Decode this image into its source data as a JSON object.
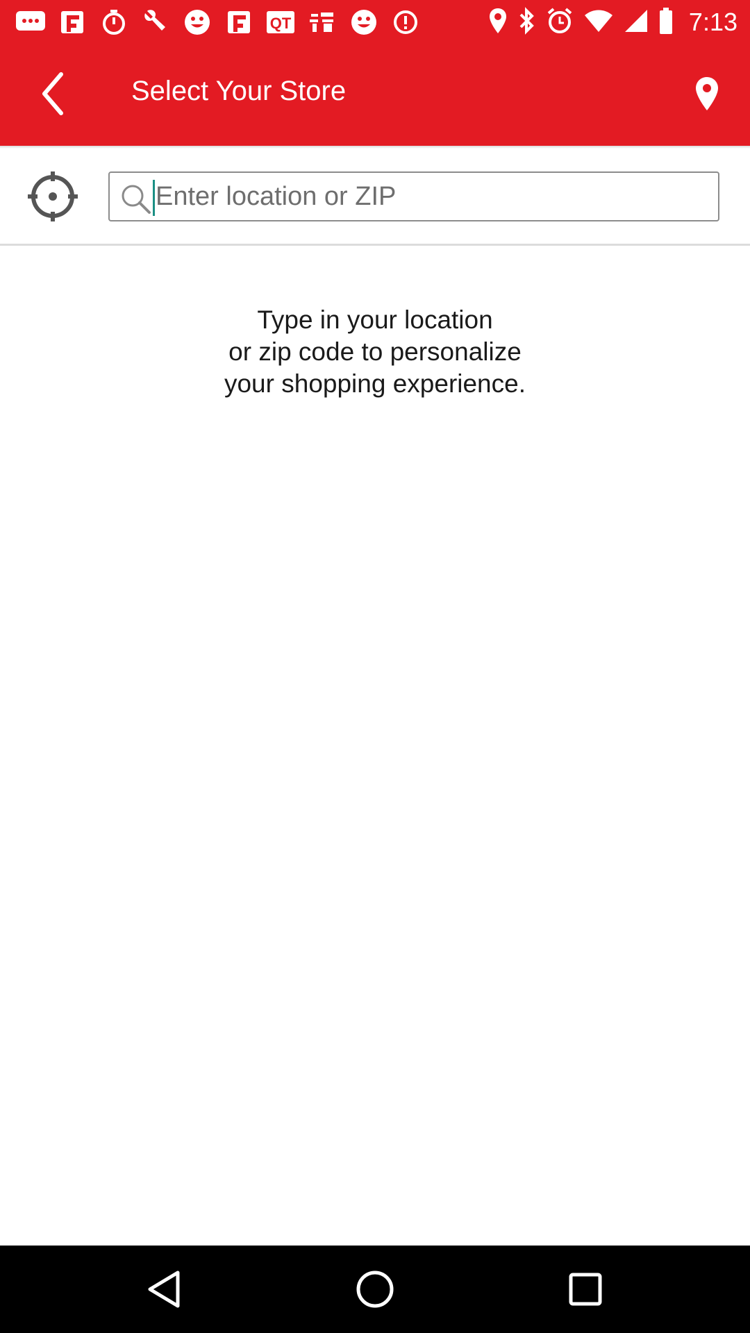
{
  "status_bar": {
    "time": "7:13",
    "left_icons": [
      "messages-icon",
      "flipboard-icon",
      "stopwatch-icon",
      "wrench-icon",
      "smiley-icon",
      "flipboard-icon",
      "qt-icon",
      "taobao-icon",
      "smiley-icon",
      "info-icon"
    ],
    "right_icons": [
      "location-icon",
      "bluetooth-icon",
      "alarm-icon",
      "wifi-icon",
      "signal-icon",
      "battery-icon"
    ]
  },
  "app_bar": {
    "title": "Select Your Store",
    "accent_color": "#e31b23"
  },
  "search": {
    "placeholder": "Enter location or ZIP",
    "value": ""
  },
  "message": "Type in your location\nor zip code to personalize\nyour shopping experience."
}
